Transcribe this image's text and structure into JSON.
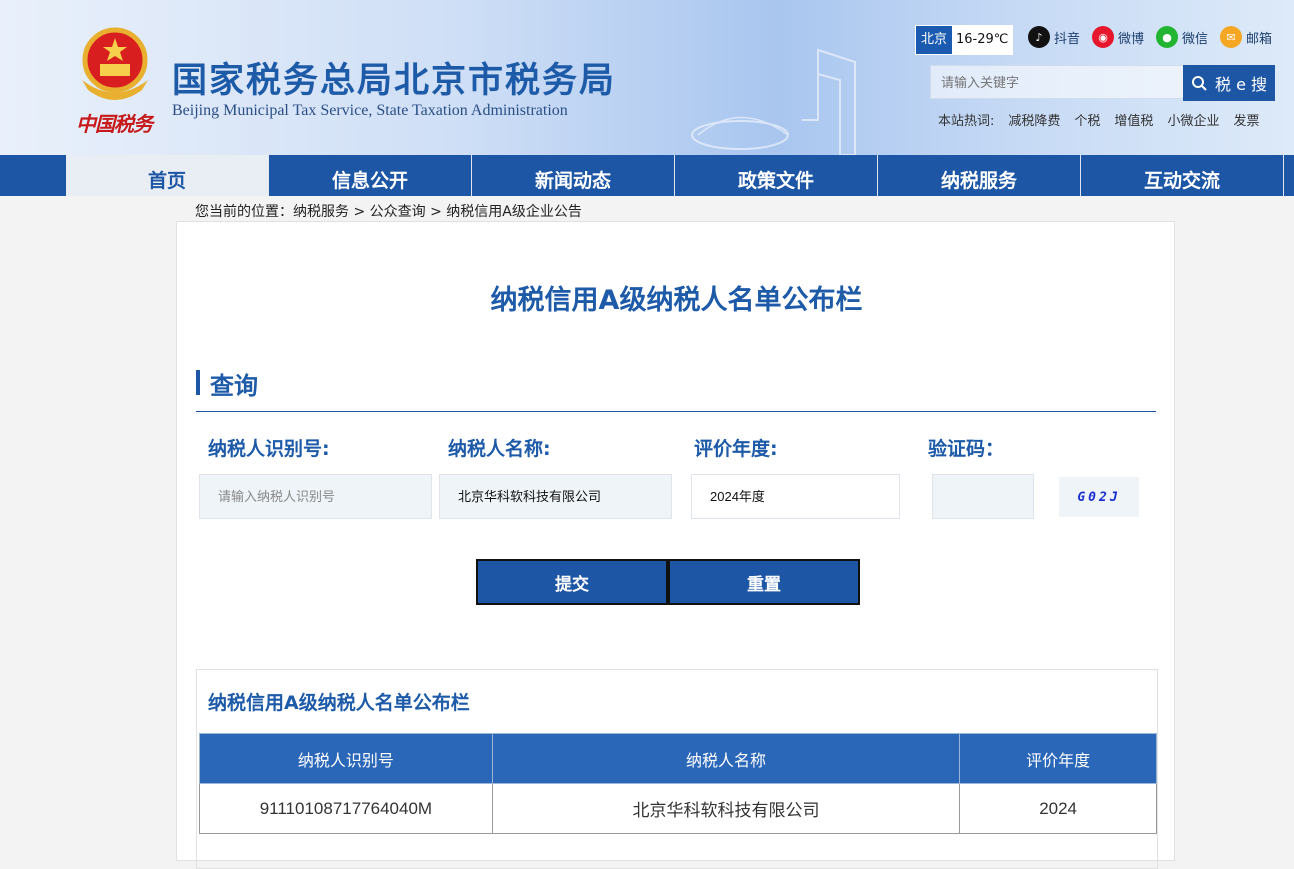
{
  "header": {
    "title": "国家税务总局北京市税务局",
    "subtitle": "Beijing Municipal Tax Service, State Taxation Administration",
    "seal_text": "中国税务",
    "weather": {
      "city": "北京",
      "temp": "16-29℃"
    },
    "social": [
      {
        "label": "抖音",
        "icon": "douyin-icon",
        "color": "#111111"
      },
      {
        "label": "微博",
        "icon": "weibo-icon",
        "color": "#e6162d"
      },
      {
        "label": "微信",
        "icon": "wechat-icon",
        "color": "#21b532"
      },
      {
        "label": "邮箱",
        "icon": "mail-icon",
        "color": "#f5a623"
      }
    ],
    "search": {
      "placeholder": "请输入关键字",
      "button": "税 e 搜"
    },
    "hot": {
      "label": "本站热词:",
      "words": [
        "减税降费",
        "个税",
        "增值税",
        "小微企业",
        "发票"
      ]
    }
  },
  "nav": [
    "首页",
    "信息公开",
    "新闻动态",
    "政策文件",
    "纳税服务",
    "互动交流"
  ],
  "breadcrumb": "您当前的位置：纳税服务 > 公众查询 > 纳税信用A级企业公告",
  "main": {
    "title": "纳税信用A级纳税人名单公布栏",
    "section": "查询",
    "fields": {
      "id_label": "纳税人识别号:",
      "id_placeholder": "请输入纳税人识别号",
      "name_label": "纳税人名称:",
      "name_value": "北京华科软科技有限公司",
      "year_label": "评价年度:",
      "year_value": "2024年度",
      "captcha_label": "验证码：",
      "captcha_code": "G02J"
    },
    "buttons": {
      "submit": "提交",
      "reset": "重置"
    },
    "result": {
      "title": "纳税信用A级纳税人名单公布栏",
      "columns": [
        "纳税人识别号",
        "纳税人名称",
        "评价年度"
      ],
      "rows": [
        [
          "91110108717764040M",
          "北京华科软科技有限公司",
          "2024"
        ]
      ]
    }
  }
}
